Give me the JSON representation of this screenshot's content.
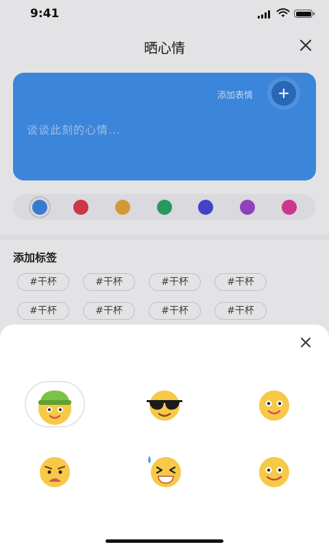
{
  "status_bar": {
    "time": "9:41"
  },
  "header": {
    "title": "晒心情"
  },
  "note": {
    "add_emoji_label": "添加表情",
    "placeholder": "谈谈此刻的心情..."
  },
  "colors": {
    "options": [
      "#3b83de",
      "#d93a4a",
      "#e0a43a",
      "#27a462",
      "#4a46d6",
      "#9b45c9",
      "#d83a9a"
    ],
    "selected_index": 0
  },
  "tags": {
    "title": "添加标签",
    "items": [
      "#干杯",
      "#干杯",
      "#干杯",
      "#干杯",
      "#干杯",
      "#干杯",
      "#干杯",
      "#干杯"
    ]
  },
  "emoji_picker": {
    "emojis": [
      "green-beanie-smile-icon",
      "sunglasses-smile-icon",
      "happy-smile-icon",
      "upset-frown-icon",
      "sweat-laugh-icon",
      "calm-smile-icon"
    ],
    "selected_index": 0
  }
}
